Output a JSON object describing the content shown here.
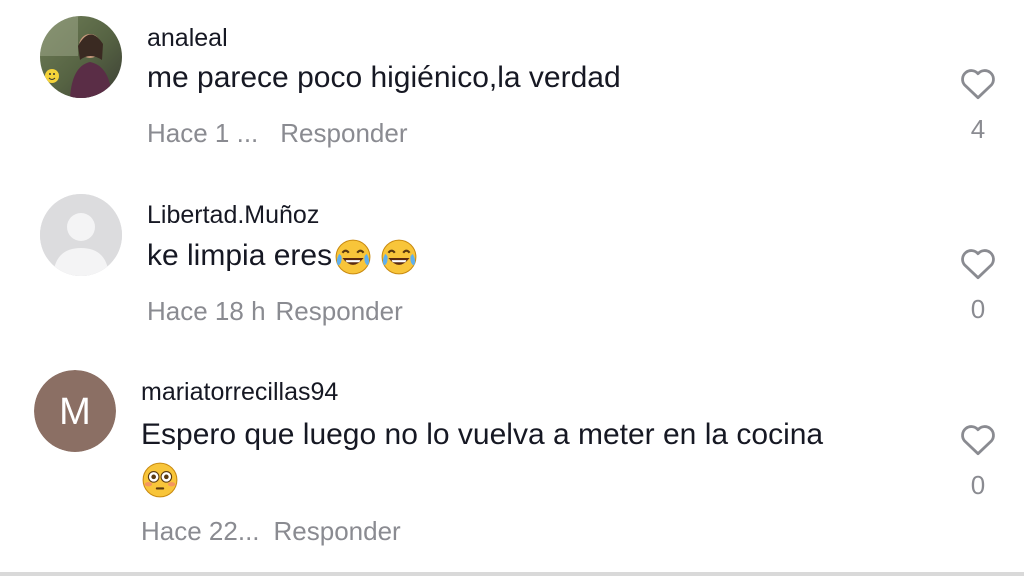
{
  "comments": [
    {
      "username": "analeal",
      "text": "me parece poco higiénico,la verdad",
      "time": "Hace 1 ...",
      "reply": "Responder",
      "likes": "4",
      "avatar": "photo"
    },
    {
      "username": "Libertad.Muñoz",
      "text": "ke limpia eres",
      "emojis": [
        "face-with-tears-of-joy",
        "face-with-tears-of-joy"
      ],
      "time": "Hace 18 h",
      "reply": "Responder",
      "likes": "0",
      "avatar": "default-gray"
    },
    {
      "username": "mariatorrecillas94",
      "text": "Espero que luego no lo vuelva a meter en la cocina",
      "emojis": [
        "flushed-face"
      ],
      "time": "Hace 22...",
      "reply": "Responder",
      "likes": "0",
      "avatar_letter": "M",
      "avatar_color": "#8b6f64"
    }
  ]
}
